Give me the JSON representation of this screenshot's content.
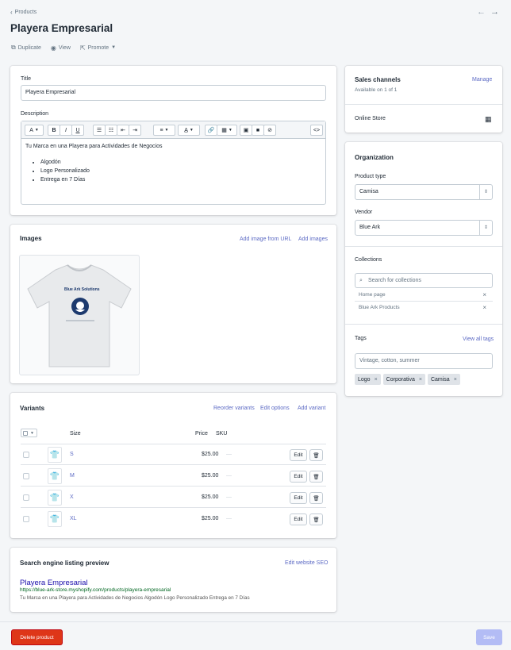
{
  "breadcrumb": {
    "label": "Products"
  },
  "page": {
    "title": "Playera Empresarial"
  },
  "actions": {
    "duplicate": "Duplicate",
    "view": "View",
    "promote": "Promote"
  },
  "main": {
    "title_label": "Title",
    "title_value": "Playera Empresarial",
    "description_label": "Description",
    "description_text": "Tu Marca en una Playera para Actividades de Negocios",
    "description_bullets": [
      "Algodón",
      "Logo Personalizado",
      "Entrega en 7 Días"
    ],
    "toolbar": {
      "font": "A",
      "bold": "B",
      "italic": "I",
      "underline": "U",
      "code": "<>"
    }
  },
  "images": {
    "title": "Images",
    "add_from_url": "Add image from URL",
    "add_images": "Add images",
    "shirt_text": "Blue Ark Solutions"
  },
  "variants": {
    "title": "Variants",
    "reorder": "Reorder variants",
    "edit_options": "Edit options",
    "add_variant": "Add variant",
    "headers": {
      "size": "Size",
      "price": "Price",
      "sku": "SKU"
    },
    "edit_label": "Edit",
    "rows": [
      {
        "size": "S",
        "price": "$25.00",
        "sku": "—"
      },
      {
        "size": "M",
        "price": "$25.00",
        "sku": "—"
      },
      {
        "size": "X",
        "price": "$25.00",
        "sku": "—"
      },
      {
        "size": "XL",
        "price": "$25.00",
        "sku": "—"
      }
    ]
  },
  "seo": {
    "title": "Search engine listing preview",
    "edit_link": "Edit website SEO",
    "preview_title": "Playera Empresarial",
    "preview_url": "https://blue-ark-store.myshopify.com/products/playera-empresarial",
    "preview_desc": "Tu Marca en una Playera para Actividades de Negocios Algodón Logo Personalizado Entrega en 7 Días"
  },
  "sales_channels": {
    "title": "Sales channels",
    "manage": "Manage",
    "available": "Available on 1 of 1",
    "online_store": "Online Store"
  },
  "organization": {
    "title": "Organization",
    "product_type_label": "Product type",
    "product_type_value": "Camisa",
    "vendor_label": "Vendor",
    "vendor_value": "Blue Ark",
    "collections_label": "Collections",
    "collections_placeholder": "Search for collections",
    "collections": [
      "Home page",
      "Blue Ark Products"
    ],
    "tags_label": "Tags",
    "view_all_tags": "View all tags",
    "tags_placeholder": "Vintage, cotton, summer",
    "tags": [
      "Logo",
      "Corporativa",
      "Camisa"
    ]
  },
  "footer": {
    "delete": "Delete product",
    "save": "Save"
  },
  "colors": {
    "accent": "#5c6ac4",
    "danger": "#de3618",
    "save_disabled": "#b3bcf5"
  }
}
